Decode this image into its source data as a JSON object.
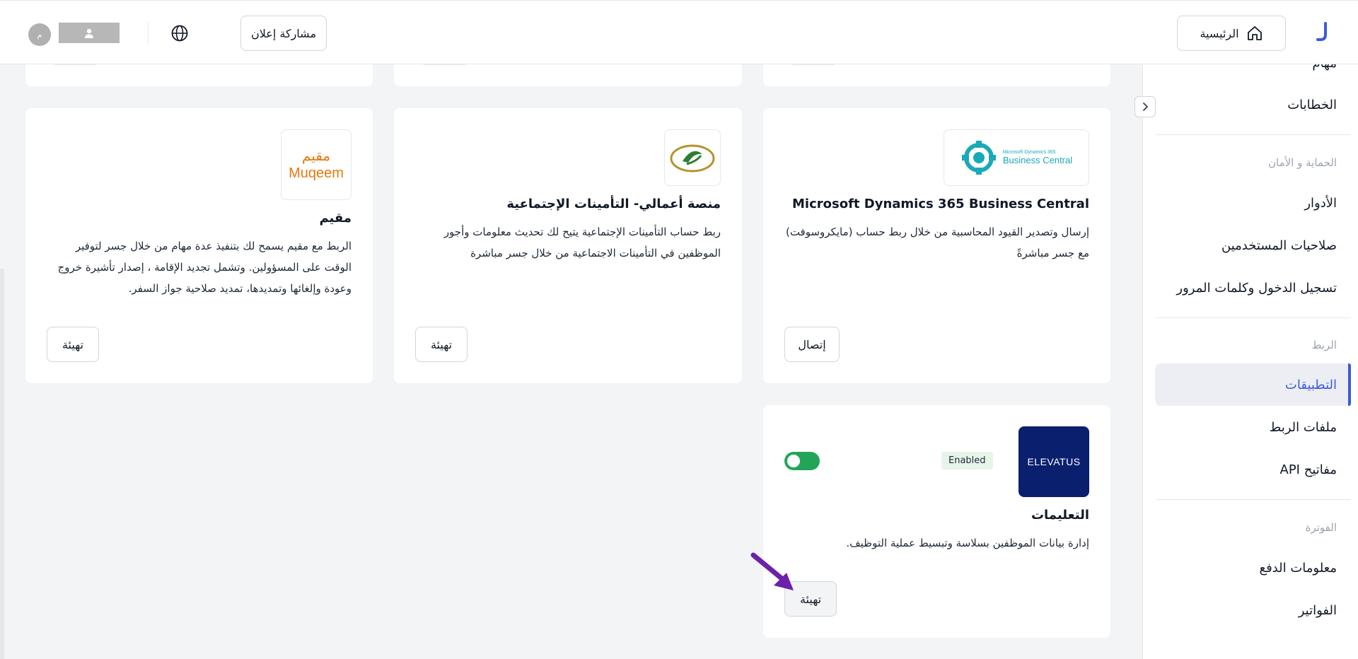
{
  "header": {
    "home_label": "الرئيسية",
    "share_label": "مشاركة إعلان",
    "avatar_initial": "م"
  },
  "sidebar": {
    "tasks_partial": "مهام",
    "letters": "الخطابات",
    "security_heading": "الحماية و الأمان",
    "roles": "الأدوار",
    "user_permissions": "صلاحيات المستخدمين",
    "login_passwords": "تسجيل الدخول وكلمات المرور",
    "integration_heading": "الربط",
    "apps": "التطبيقات",
    "integration_files": "ملفات الربط",
    "api_keys": "مفاتيح API",
    "billing_heading": "الفوترة",
    "payment_info": "معلومات الدفع",
    "invoices": "الفواتير"
  },
  "cards": {
    "dynamics": {
      "logo_line1": "Microsoft Dynamics 365",
      "logo_line2": "Business Central",
      "title": "Microsoft Dynamics 365 Business Central",
      "desc": "إرسال وتصدير القيود المحاسبية من خلال ربط حساب (مايكروسوفت) مع جسر مباشرةً",
      "button": "إتصال"
    },
    "gosi": {
      "title": "منصة أعمالي- التأمينات الإجتماعية",
      "desc": "ربط حساب التأمينات الإجتماعية يتيح لك تحديث معلومات وأجور الموظفين في التأمينات الاجتماعية من خلال جسر مباشرة",
      "button": "تهيئة"
    },
    "muqeem": {
      "logo_ar": "مقيم",
      "logo_en": "Muqeem",
      "title": "مقيم",
      "desc": "الربط مع مقيم يسمح لك بتنفيذ عدة مهام من خلال جسر لتوفير الوقت على المسؤولين. وتشمل تجديد الإقامة ، إصدار تأشيرة خروج وعودة وإلغائها وتمديدها، تمديد صلاحية جواز السفر.",
      "button": "تهيئة"
    },
    "elevatus": {
      "logo_text": "ELEVATUS",
      "badge": "Enabled",
      "title": "التعليمات",
      "desc": "إدارة بيانات الموظفين بسلاسة وتبسيط عملية التوظيف.",
      "button": "تهيئة"
    }
  },
  "colors": {
    "accent": "#3b5bdb",
    "toggle_on": "#22a559",
    "elevatus_bg": "#0a1f6e",
    "muqeem_orange": "#e8770e",
    "arrow": "#6b21a8"
  }
}
